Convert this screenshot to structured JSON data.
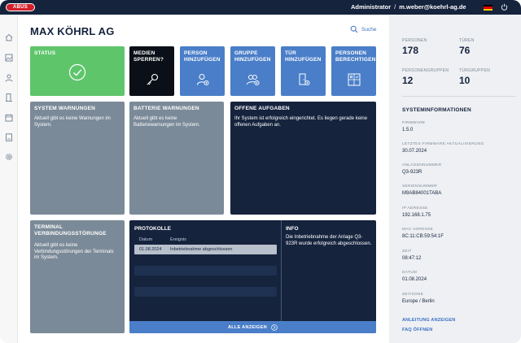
{
  "header": {
    "logo_text": "ABUS",
    "role": "Administrator",
    "separator": "/",
    "email": "m.weber@koehrl-ag.de"
  },
  "main": {
    "title": "MAX KÖHRL AG",
    "search_label": "Suche",
    "tiles": {
      "status": "STATUS",
      "medien": "MEDIEN SPERREN?",
      "person": "PERSON HINZUFÜGEN",
      "gruppe": "GRUPPE HINZUFÜGEN",
      "tuer": "TÜR HINZUFÜGEN",
      "berechtigen": "PERSONEN BERECHTIGEN"
    },
    "system_warnings": {
      "title": "SYSTEM WARNUNGEN",
      "text": "Aktuell gibt es keine Warnungen im System."
    },
    "battery_warnings": {
      "title": "BATTERIE WARNUNGEN",
      "text": "Aktuell gibt es keine Batteriewarnungen im System."
    },
    "open_tasks": {
      "title": "OFFENE AUFGABEN",
      "text": "Ihr System ist erfolgreich eingerichtet. Es liegen gerade keine offenen Aufgaben an."
    },
    "terminal": {
      "title": "TERMINAL VERBINDUNGSSTÖRUNGE",
      "text": "Aktuell gibt es keine Verbindungsstörungen der Terminals im System."
    },
    "protocol": {
      "title": "PROTOKOLLE",
      "col_date": "Datum",
      "col_event": "Ereignis",
      "rows": [
        {
          "date": "01.08.2024",
          "event": "Inbetriebnahme abgeschlossen"
        }
      ],
      "show_all": "ALLE ANZEIGEN"
    },
    "info": {
      "title": "INFO",
      "text": "Die Inbetriebnahme der Anlage Q3-923R wurde erfolgreich abgeschlossen."
    }
  },
  "sidebar_right": {
    "stats": [
      {
        "label": "PERSONEN",
        "value": "178"
      },
      {
        "label": "TÜREN",
        "value": "76"
      },
      {
        "label": "PERSONENGRUPPEN",
        "value": "12"
      },
      {
        "label": "TÜRGRUPPEN",
        "value": "10"
      }
    ],
    "section_title": "SYSTEMINFORMATIONEN",
    "info": [
      {
        "label": "FIRMWARE",
        "value": "1.5.0"
      },
      {
        "label": "LETZTES FIRMWARE AKTUALISIERUNG",
        "value": "30.07.2024"
      },
      {
        "label": "ANLAGENNUMMER",
        "value": "Q3-923R"
      },
      {
        "label": "SERIENNUMMER",
        "value": "M9AB84001TABA"
      },
      {
        "label": "IP ADRESSE",
        "value": "192.168.1.75"
      },
      {
        "label": "MAC ADRESSE",
        "value": "8C:11:CB:59:54:1F"
      },
      {
        "label": "ZEIT",
        "value": "08:47:12"
      },
      {
        "label": "DATUM",
        "value": "01.08.2024"
      },
      {
        "label": "ZEITZONE",
        "value": "Europe / Berlin"
      }
    ],
    "links": {
      "manual": "ANLEITUNG ANZEIGEN",
      "faq": "FAQ ÖFFNEN"
    }
  },
  "colors": {
    "navy": "#15233d",
    "green": "#5ec56b",
    "blue": "#4a7ec8",
    "grey": "#7b8a98",
    "red": "#d3202a"
  },
  "icons": [
    "home-icon",
    "image-icon",
    "person-icon",
    "door-icon",
    "calendar-icon",
    "document-icon",
    "gear-icon",
    "search-icon",
    "power-icon",
    "flag-icon",
    "check-icon",
    "key-icon"
  ]
}
